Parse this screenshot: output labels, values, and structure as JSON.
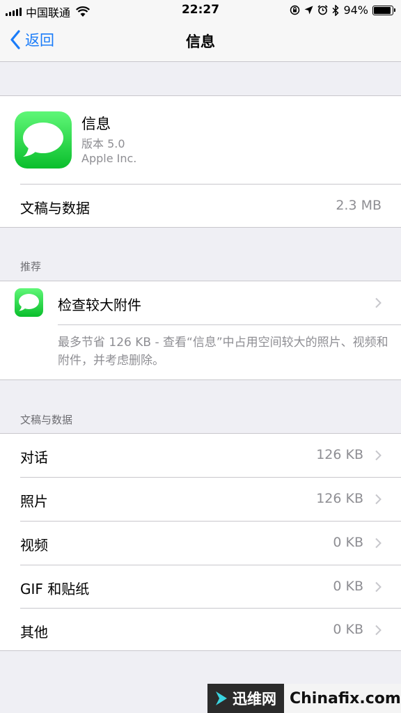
{
  "status_bar": {
    "carrier": "中国联通",
    "time": "22:27",
    "battery_percent": "94%",
    "battery_level": 0.94
  },
  "nav": {
    "back_label": "返回",
    "title": "信息"
  },
  "app": {
    "name": "信息",
    "version": "版本 5.0",
    "vendor": "Apple Inc.",
    "docs_label": "文稿与数据",
    "docs_value": "2.3 MB"
  },
  "recommendations": {
    "header": "推荐",
    "item_label": "检查较大附件",
    "description": "最多节省 126 KB - 查看“信息”中占用空间较大的照片、视频和附件，并考虑删除。"
  },
  "documents": {
    "header": "文稿与数据",
    "rows": [
      {
        "label": "对话",
        "value": "126 KB"
      },
      {
        "label": "照片",
        "value": "126 KB"
      },
      {
        "label": "视频",
        "value": "0 KB"
      },
      {
        "label": "GIF 和贴纸",
        "value": "0 KB"
      },
      {
        "label": "其他",
        "value": "0 KB"
      }
    ]
  },
  "watermark": {
    "left_text": "迅维网",
    "right_text": "Chinafix.com"
  },
  "colors": {
    "accent": "#1a7cf9",
    "background": "#efeff4",
    "secondary_text": "#8e8e93",
    "icon_green": "#1ed43f"
  },
  "icons": [
    "signal-icon",
    "wifi-icon",
    "rotation-lock-icon",
    "location-icon",
    "alarm-icon",
    "bluetooth-icon",
    "battery-icon",
    "chevron-left-icon",
    "messages-app-icon",
    "chevron-right-icon"
  ]
}
